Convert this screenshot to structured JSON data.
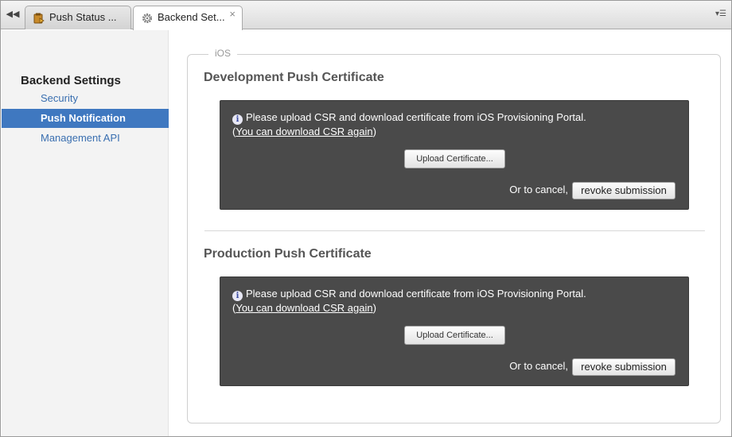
{
  "tabs": [
    {
      "label": "Push Status ...",
      "icon": "push-status-icon"
    },
    {
      "label": "Backend Set...",
      "icon": "gear-icon",
      "close": "×"
    }
  ],
  "toolbar": {
    "back_glyph": "◀◀",
    "menu_glyph": "▾☰"
  },
  "sidebar": {
    "title": "Backend Settings",
    "items": [
      {
        "label": "Security"
      },
      {
        "label": "Push Notification",
        "selected": true
      },
      {
        "label": "Management API"
      }
    ]
  },
  "panel": {
    "legend": "iOS",
    "sections": [
      {
        "title": "Development Push Certificate",
        "info": "Please upload CSR and download certificate from iOS Provisioning Portal.",
        "csr_open": "(",
        "csr_link": "You can download CSR again",
        "csr_close": ")",
        "upload_label": "Upload Certificate...",
        "cancel_text": "Or to cancel,",
        "revoke_label": "revoke submission"
      },
      {
        "title": "Production Push Certificate",
        "info": "Please upload CSR and download certificate from iOS Provisioning Portal.",
        "csr_open": "(",
        "csr_link": "You can download CSR again",
        "csr_close": ")",
        "upload_label": "Upload Certificate...",
        "cancel_text": "Or to cancel,",
        "revoke_label": "revoke submission"
      }
    ]
  },
  "colors": {
    "selected": "#3f78c0",
    "link": "#3a6fb0",
    "box": "#4a4a4a"
  }
}
